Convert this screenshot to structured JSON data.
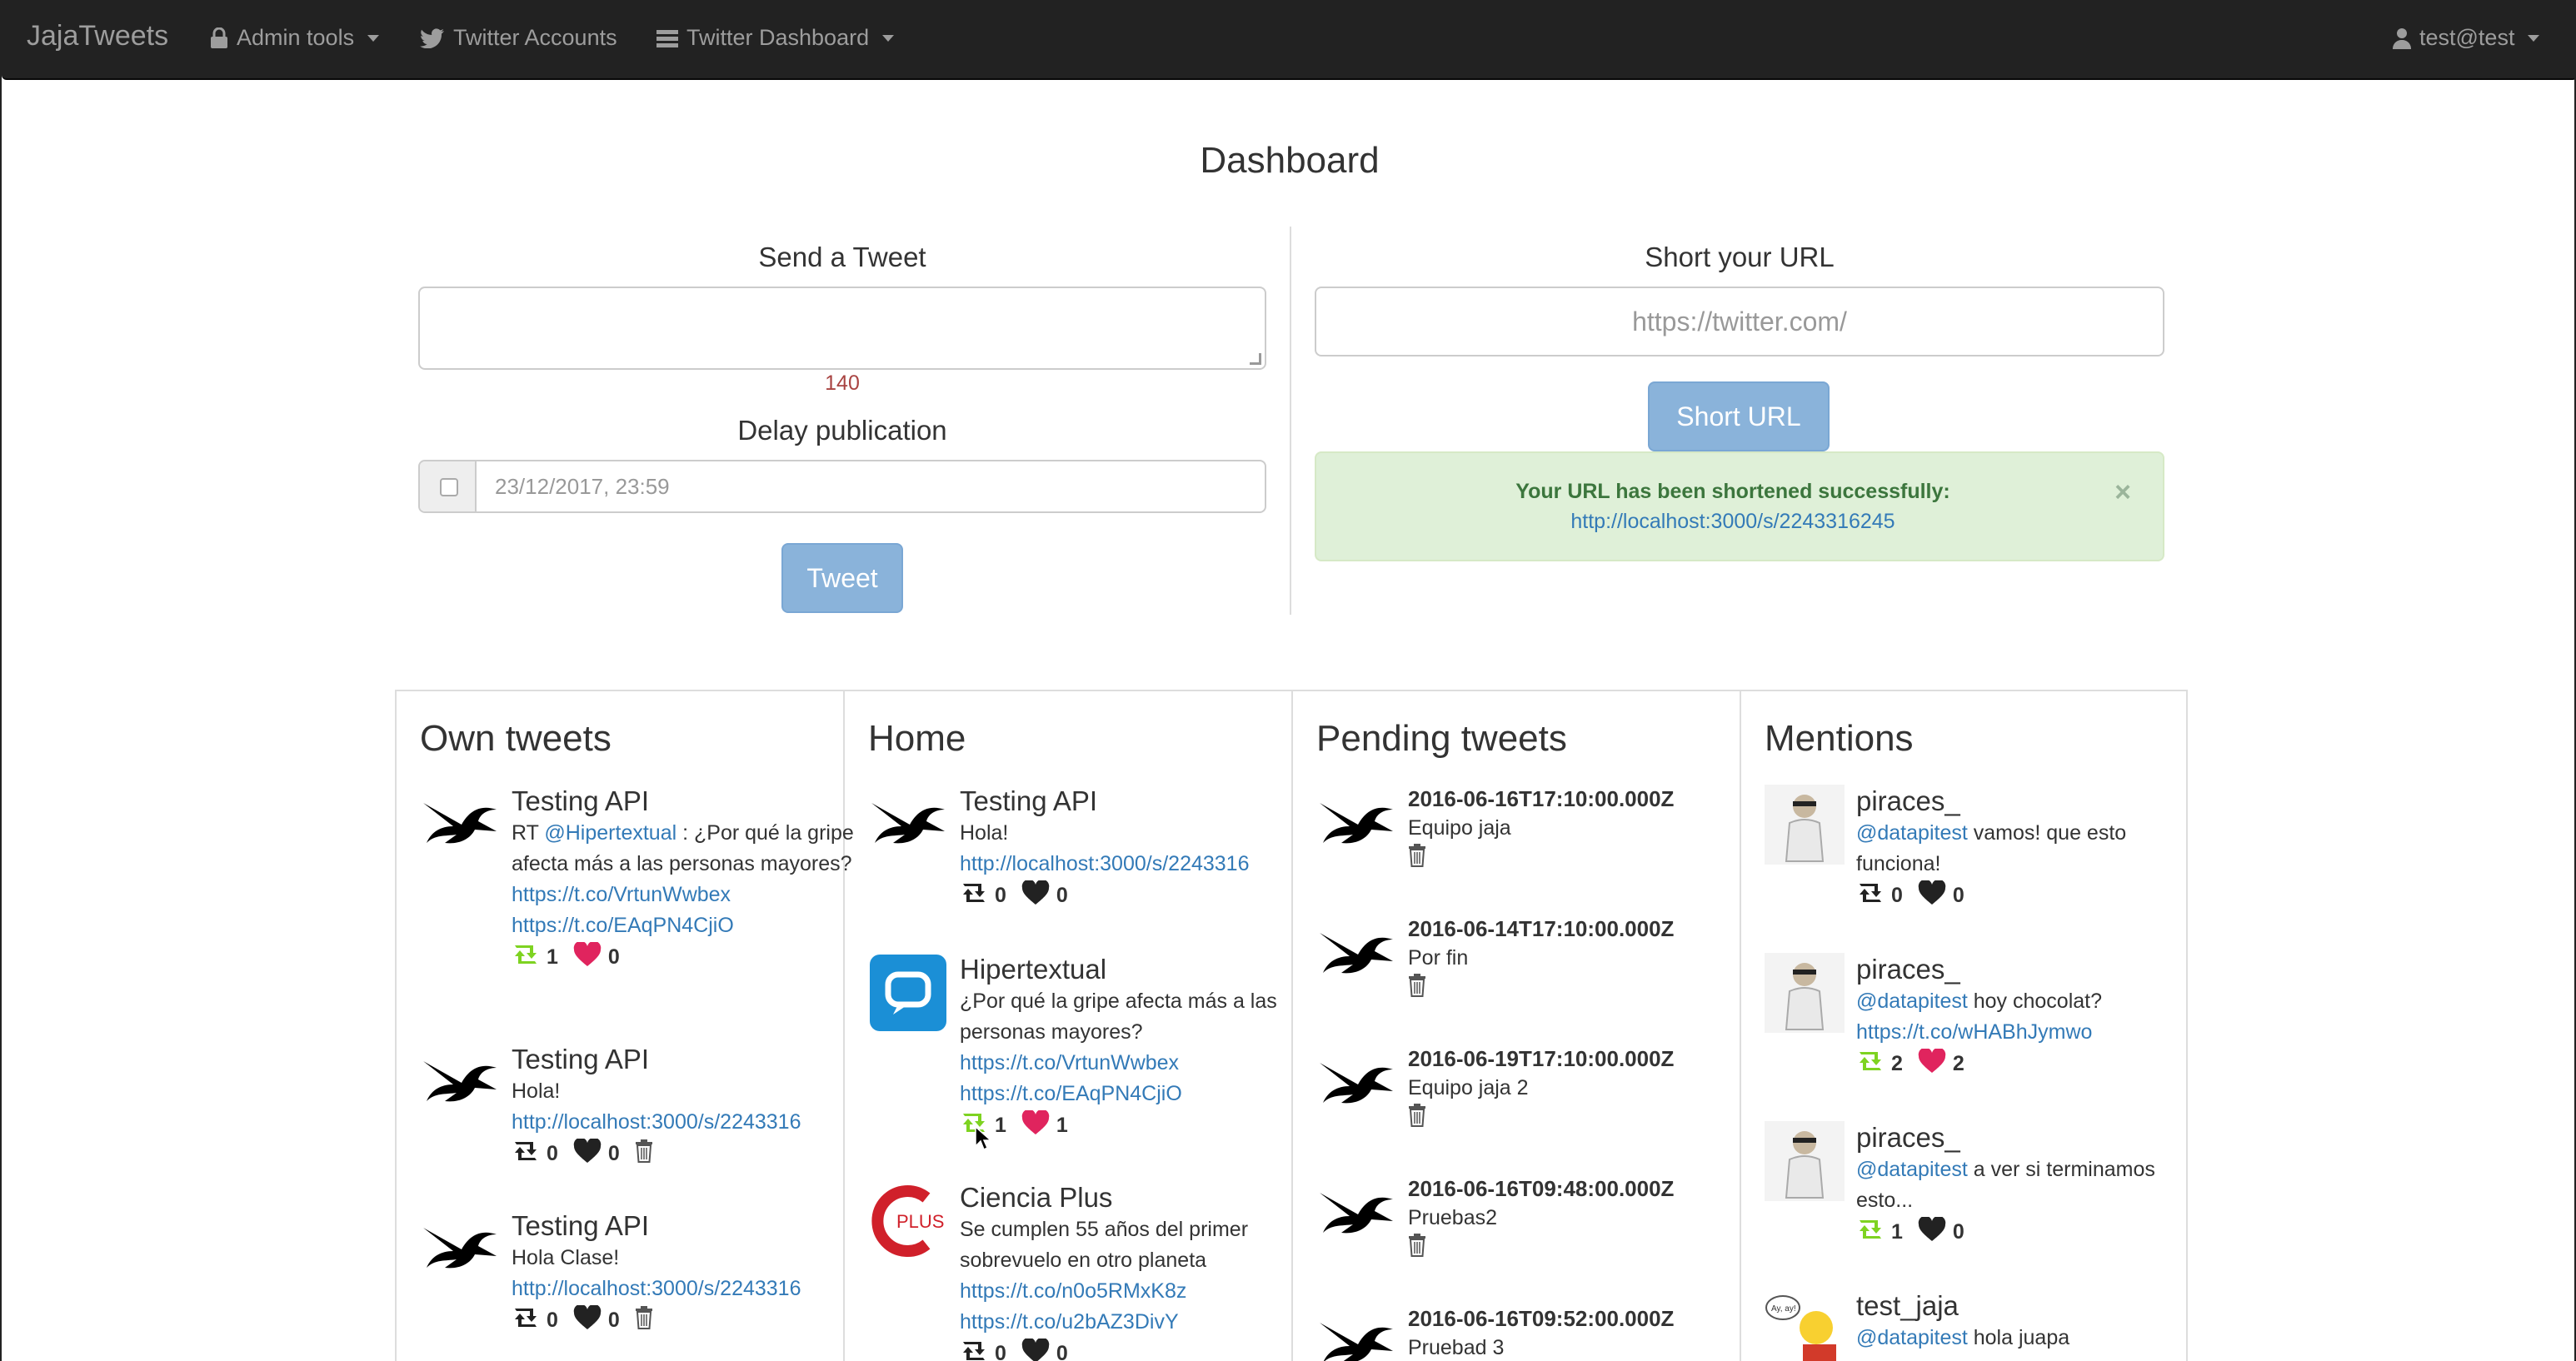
{
  "nav": {
    "brand": "JajaTweets",
    "admin_tools": "Admin tools",
    "twitter_accounts": "Twitter Accounts",
    "twitter_dashboard": "Twitter Dashboard",
    "user": "test@test"
  },
  "page_title": "Dashboard",
  "send_tweet": {
    "title": "Send a Tweet",
    "text_value": "",
    "counter": "140",
    "delay_title": "Delay publication",
    "date_value": "23/12/2017, 23:59",
    "tweet_button": "Tweet"
  },
  "short_url": {
    "title": "Short your URL",
    "placeholder": "https://twitter.com/",
    "button": "Short URL",
    "alert_message": "Your URL has been shortened successfully:",
    "alert_link": "http://localhost:3000/s/2243316245",
    "alert_close": "×"
  },
  "own_tweets": {
    "title": "Own tweets",
    "tweets": [
      {
        "name": "Testing API",
        "prefix": "RT ",
        "mention": "@Hipertextual",
        "text": " : ¿Por qué la gripe afecta más a las personas mayores?",
        "link1": "https://t.co/VrtunWwbex",
        "link2": "https://t.co/EAqPN4CjiO",
        "retweets": "1",
        "likes": "0"
      },
      {
        "name": "Testing API",
        "text": "Hola!",
        "link1": "http://localhost:3000/s/2243316",
        "retweets": "0",
        "likes": "0"
      },
      {
        "name": "Testing API",
        "text": "Hola Clase!",
        "link1": "http://localhost:3000/s/2243316",
        "retweets": "0",
        "likes": "0"
      }
    ]
  },
  "home": {
    "title": "Home",
    "tweets": [
      {
        "name": "Testing API",
        "text": "Hola!",
        "link1": "http://localhost:3000/s/2243316",
        "retweets": "0",
        "likes": "0"
      },
      {
        "name": "Hipertextual",
        "text": "¿Por qué la gripe afecta más a las personas mayores?",
        "link1": "https://t.co/VrtunWwbex",
        "link2": "https://t.co/EAqPN4CjiO",
        "retweets": "1",
        "likes": "1"
      },
      {
        "name": "Ciencia Plus",
        "text": "Se cumplen 55 años del primer sobrevuelo en otro planeta",
        "link1": "https://t.co/n0o5RMxK8z",
        "link2": "https://t.co/u2bAZ3DivY",
        "retweets": "0",
        "likes": "0",
        "avatar_text": "PLUS"
      }
    ]
  },
  "pending": {
    "title": "Pending tweets",
    "tweets": [
      {
        "date": "2016-06-16T17:10:00.000Z",
        "text": "Equipo jaja"
      },
      {
        "date": "2016-06-14T17:10:00.000Z",
        "text": "Por fin"
      },
      {
        "date": "2016-06-19T17:10:00.000Z",
        "text": "Equipo jaja 2"
      },
      {
        "date": "2016-06-16T09:48:00.000Z",
        "text": "Pruebas2"
      },
      {
        "date": "2016-06-16T09:52:00.000Z",
        "text": "Pruebad 3"
      }
    ]
  },
  "mentions": {
    "title": "Mentions",
    "tweets": [
      {
        "name": "piraces_",
        "mention": "@datapitest",
        "text": " vamos! que esto funciona!",
        "retweets": "0",
        "likes": "0"
      },
      {
        "name": "piraces_",
        "mention": "@datapitest",
        "text": " hoy chocolat?",
        "link1": "https://t.co/wHABhJymwo",
        "retweets": "2",
        "likes": "2"
      },
      {
        "name": "piraces_",
        "mention": "@datapitest",
        "text": " a ver si terminamos esto...",
        "retweets": "1",
        "likes": "0"
      },
      {
        "name": "test_jaja",
        "mention": "@datapitest",
        "text": " hola juapa",
        "avatar_text": "Ay, ay!"
      }
    ]
  },
  "colors": {
    "link": "#337ab7",
    "retweet_active": "#7ed321",
    "like_active": "#e0245e",
    "button": "#8ab3da",
    "alert_bg": "#dff0d8"
  }
}
